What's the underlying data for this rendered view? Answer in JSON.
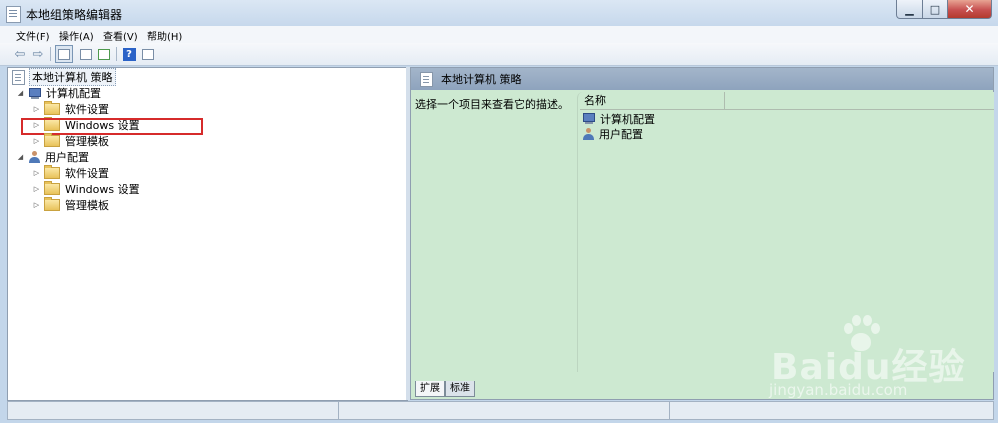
{
  "window": {
    "title": "本地组策略编辑器"
  },
  "menu": [
    "文件(F)",
    "操作(A)",
    "查看(V)",
    "帮助(H)"
  ],
  "toolbar": {
    "icons": [
      "back-arrow-icon",
      "forward-arrow-icon",
      "console-tree-icon",
      "properties-icon",
      "export-list-icon",
      "help-icon",
      "show-hide-pane-icon"
    ],
    "help_glyph": "?"
  },
  "tree": {
    "root": "本地计算机 策略",
    "computer_config": "计算机配置",
    "user_config": "用户配置",
    "computer_children": [
      "软件设置",
      "Windows 设置",
      "管理模板"
    ],
    "user_children": [
      "软件设置",
      "Windows 设置",
      "管理模板"
    ],
    "expanded_glyph": "◢",
    "collapsed_glyph": "▷"
  },
  "right_pane": {
    "header": "本地计算机 策略",
    "description": "选择一个项目来查看它的描述。",
    "column_name": "名称",
    "items": [
      "计算机配置",
      "用户配置"
    ]
  },
  "tabs": {
    "extended": "扩展",
    "standard": "标准"
  },
  "watermark": {
    "logo": "Baidu经验",
    "url": "jingyan.baidu.com"
  },
  "colors": {
    "right_pane_bg": "#cde9d1",
    "highlight_box": "#d62b2b",
    "title_bar": "#c6d8ec"
  }
}
